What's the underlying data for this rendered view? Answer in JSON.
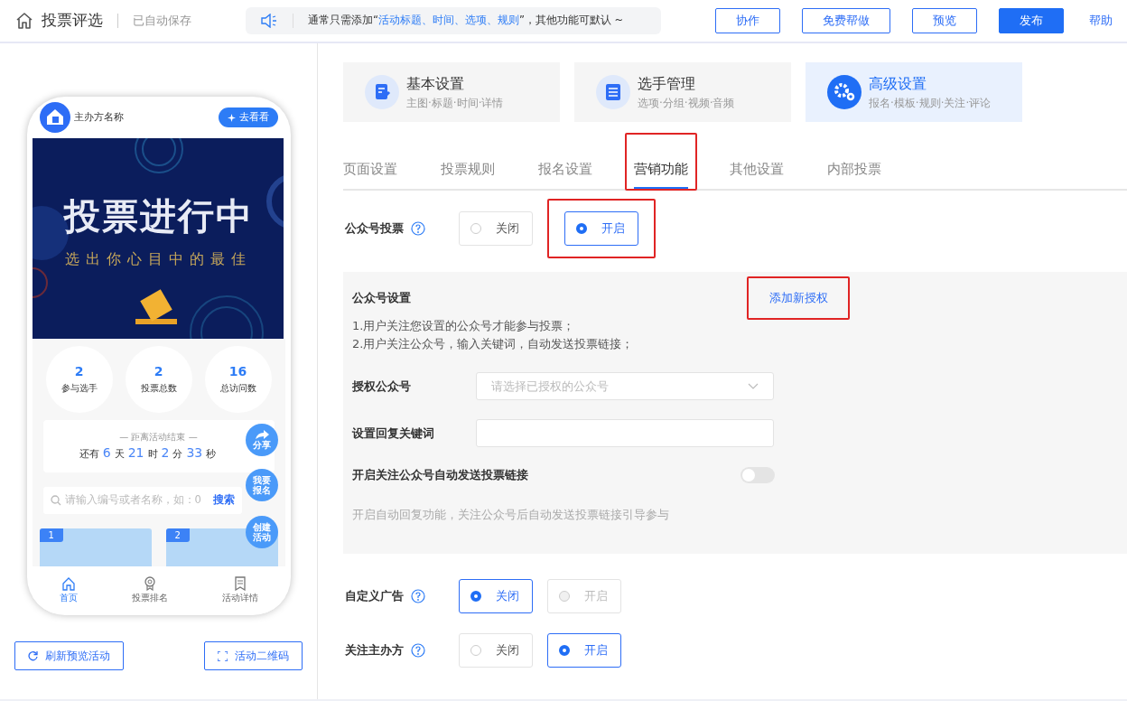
{
  "header": {
    "title": "投票评选",
    "autosave": "已自动保存",
    "notice": {
      "before": "通常只需添加“",
      "highlight": "活动标题、时间、选项、规则",
      "after": "”，其他功能可默认 ~"
    },
    "buttons": [
      {
        "label": "协作",
        "kind": "outline"
      },
      {
        "label": "免费帮做",
        "kind": "outline"
      },
      {
        "label": "预览",
        "kind": "outline"
      },
      {
        "label": "发布",
        "kind": "primary"
      }
    ],
    "help": "帮助"
  },
  "preview": {
    "org_name": "主办方名称",
    "go_button": "去看看",
    "banner": {
      "title": "投票进行中",
      "subtitle": "选出你心目中的最佳"
    },
    "stats": [
      {
        "value": "2",
        "label": "参与选手"
      },
      {
        "value": "2",
        "label": "投票总数"
      },
      {
        "value": "16",
        "label": "总访问数"
      }
    ],
    "countdown": {
      "caption": "— 距离活动结束 —",
      "prefix": "还有",
      "parts": [
        {
          "value": "6",
          "unit": "天"
        },
        {
          "value": "21",
          "unit": "时"
        },
        {
          "value": "2",
          "unit": "分"
        },
        {
          "value": "33",
          "unit": "秒"
        }
      ]
    },
    "search": {
      "placeholder": "请输入编号或者名称，如：0",
      "button": "搜索"
    },
    "float_buttons": [
      {
        "label": "分享",
        "kind": "share"
      },
      {
        "label": "我要报名",
        "kind": "text"
      },
      {
        "label": "创建活动",
        "kind": "text"
      }
    ],
    "candidates": [
      {
        "number": "1"
      },
      {
        "number": "2"
      }
    ],
    "bottom_nav": [
      {
        "label": "首页",
        "selected": true,
        "kind": "home"
      },
      {
        "label": "投票排名",
        "selected": false,
        "kind": "medal"
      },
      {
        "label": "活动详情",
        "selected": false,
        "kind": "doc"
      }
    ],
    "buttons": [
      {
        "label": "刷新预览活动",
        "kind": "refresh"
      },
      {
        "label": "活动二维码",
        "kind": "scan"
      }
    ]
  },
  "steps": [
    {
      "title": "基本设置",
      "subtitle": "主图·标题·时间·详情",
      "selected": false,
      "kind": "edit"
    },
    {
      "title": "选手管理",
      "subtitle": "选项·分组·视频·音频",
      "selected": false,
      "kind": "list"
    },
    {
      "title": "高级设置",
      "subtitle": "报名·模板·规则·关注·评论",
      "selected": true,
      "kind": "gear"
    }
  ],
  "tabs": [
    {
      "label": "页面设置",
      "selected": false,
      "highlighted": false
    },
    {
      "label": "投票规则",
      "selected": false,
      "highlighted": false
    },
    {
      "label": "报名设置",
      "selected": false,
      "highlighted": false
    },
    {
      "label": "营销功能",
      "selected": true,
      "highlighted": true
    },
    {
      "label": "其他设置",
      "selected": false,
      "highlighted": false
    },
    {
      "label": "内部投票",
      "selected": false,
      "highlighted": false
    }
  ],
  "official_vote": {
    "label": "公众号投票",
    "options": [
      {
        "label": "关闭",
        "selected": false,
        "disabled": false,
        "highlighted": false
      },
      {
        "label": "开启",
        "selected": true,
        "disabled": false,
        "highlighted": true
      }
    ]
  },
  "panel": {
    "title": "公众号设置",
    "link": {
      "label": "添加新授权",
      "highlighted": true
    },
    "notes": [
      "1.用户关注您设置的公众号才能参与投票；",
      "2.用户关注公众号，输入关键词，自动发送投票链接；"
    ],
    "fields": [
      {
        "kind": "select",
        "label": "授权公众号",
        "placeholder": "请选择已授权的公众号"
      },
      {
        "kind": "input",
        "label": "设置回复关键词"
      },
      {
        "kind": "switch",
        "label": "开启关注公众号自动发送投票链接",
        "on": false
      }
    ],
    "hint": "开启自动回复功能，关注公众号后自动发送投票链接引导参与"
  },
  "more_rows": [
    {
      "label": "自定义广告",
      "options": [
        {
          "label": "关闭",
          "selected": true,
          "disabled": false
        },
        {
          "label": "开启",
          "selected": false,
          "disabled": true
        }
      ]
    },
    {
      "label": "关注主办方",
      "options": [
        {
          "label": "关闭",
          "selected": false,
          "disabled": false
        },
        {
          "label": "开启",
          "selected": true,
          "disabled": false
        }
      ]
    }
  ]
}
